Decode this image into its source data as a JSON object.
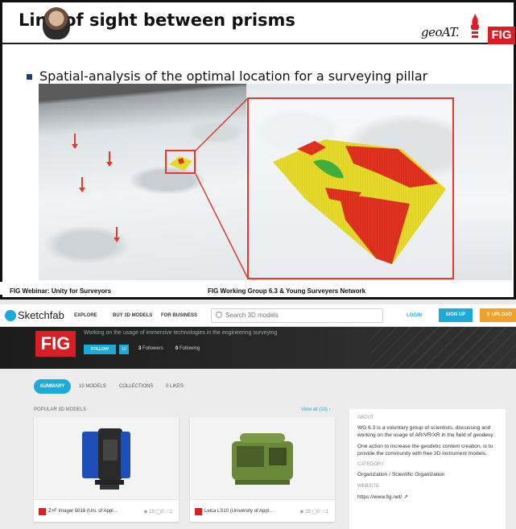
{
  "slide": {
    "title": "Line of sight between prisms",
    "bullet": "Spatial-analysis of the optimal location for a surveying pillar",
    "logo_geoat": "geoAT.",
    "logo_fig": "FIG",
    "footer_left": "FIG Webinar: Unity for Surveyors",
    "footer_right": "FIG Working Group 6.3 & Young Surveyers Network"
  },
  "sketchfab": {
    "brand": "Sketchfab",
    "nav": {
      "explore": "EXPLORE",
      "buy": "BUY 3D MODELS",
      "business": "FOR BUSINESS"
    },
    "search_placeholder": "Search 3D models",
    "login": "LOGIN",
    "signup": "SIGN UP",
    "upload": "UPLOAD",
    "profile": {
      "logo": "FIG",
      "description": "Working on the usage of immersive technologies in the engineering surveying",
      "follow": "FOLLOW",
      "follow_count": "10",
      "followers_count": "3",
      "followers_label": "Followers",
      "following_count": "0",
      "following_label": "Following"
    },
    "tabs": [
      "SUMMARY",
      "10 MODELS",
      "COLLECTIONS",
      "0 LIKES"
    ],
    "popular_label": "POPULAR 3D MODELS",
    "view_all": "View all (10)",
    "cards": [
      {
        "title": "Z+F Imager 5016 (Uni. of Appl...",
        "views": "19",
        "comments": "0",
        "likes": "1"
      },
      {
        "title": "Leica LS10 (University of Appl...",
        "views": "25",
        "comments": "0",
        "likes": "1"
      }
    ],
    "about": {
      "heading": "ABOUT",
      "text1": "WG 6.3 is a voluntary group of scientists, discussing and working on the usage of AR/VR/XR in the field of geodesy.",
      "text2": "One action to increase the geodetic content creation, is to provide the community with free 3D instrument models.",
      "category_heading": "CATEGORY",
      "category": "Organization / Scientific Organization",
      "website_heading": "WEBSITE",
      "website": "https://www.fig.net/"
    }
  },
  "colors": {
    "accent": "#1caad9",
    "upload": "#f0a128",
    "fig_red": "#d91f26",
    "highlight_red": "#e53a2b",
    "surface_yellow": "#e6d92a",
    "surface_red": "#e0321f",
    "surface_green": "#3fae3a"
  }
}
